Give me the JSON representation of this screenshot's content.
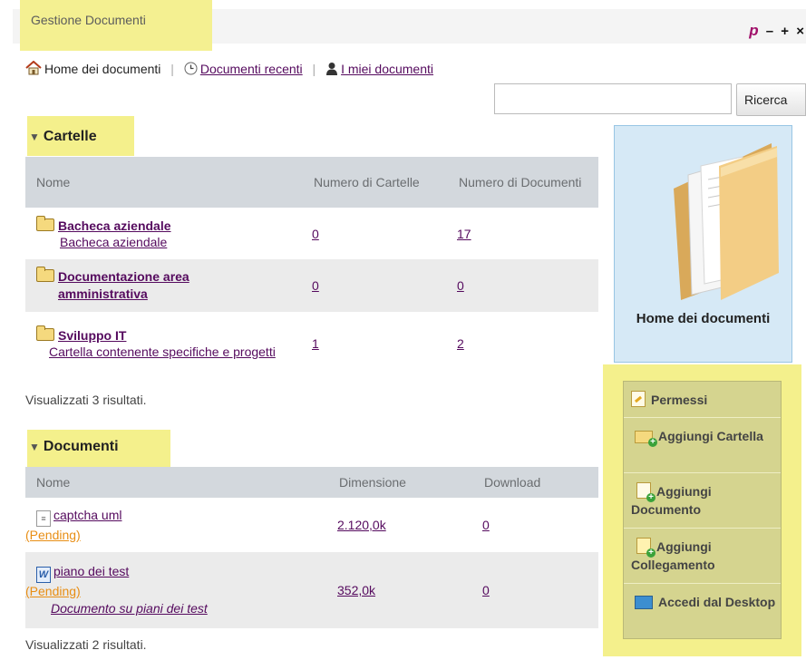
{
  "portlet": {
    "title": "Gestione Documenti",
    "controls": {
      "logo": "p",
      "minimize": "–",
      "maximize": "+",
      "close": "×"
    }
  },
  "nav": {
    "home": "Home dei documenti",
    "recent": "Documenti recenti",
    "mine": "I miei documenti"
  },
  "search": {
    "value": "",
    "button": "Ricerca"
  },
  "folders": {
    "title": "Cartelle",
    "columns": [
      "Nome",
      "Numero di Cartelle",
      "Numero di Documenti"
    ],
    "rows": [
      {
        "name": "Bacheca aziendale",
        "description": "Bacheca aziendale",
        "folders": "0",
        "documents": "17"
      },
      {
        "name": "Documentazione area amministrativa",
        "description": "",
        "folders": "0",
        "documents": "0"
      },
      {
        "name": "Sviluppo IT",
        "description": "Cartella contenente specifiche e progetti",
        "folders": "1",
        "documents": "2"
      }
    ],
    "results": "Visualizzati 3 risultati."
  },
  "documents": {
    "title": "Documenti",
    "columns": [
      "Nome",
      "Dimensione",
      "Download"
    ],
    "rows": [
      {
        "name": "captcha uml",
        "status": "(Pending)",
        "description": "",
        "size": "2.120,0k",
        "downloads": "0",
        "icon": "text-file-icon"
      },
      {
        "name": "piano dei test",
        "status": "(Pending)",
        "description": "Documento su piani dei test",
        "size": "352,0k",
        "downloads": "0",
        "icon": "word-file-icon"
      }
    ],
    "results": "Visualizzati 2 risultati."
  },
  "sidebar": {
    "title": "Home dei documenti",
    "actions": [
      {
        "label": "Permessi",
        "icon": "permissions-icon"
      },
      {
        "label": "Aggiungi Cartella",
        "icon": "add-folder-icon"
      },
      {
        "label": "Aggiungi Documento",
        "icon": "add-document-icon"
      },
      {
        "label": "Aggiungi Collegamento",
        "icon": "add-shortcut-icon"
      },
      {
        "label": "Accedi dal Desktop",
        "icon": "desktop-access-icon"
      }
    ]
  },
  "colors": {
    "highlight": "#f4f08c",
    "link": "#550a5e",
    "pending": "#e88e14",
    "table_header": "#d3d8dd",
    "sidebar_blue": "#d6e9f6",
    "sidebar_actions": "#d5d48f"
  }
}
